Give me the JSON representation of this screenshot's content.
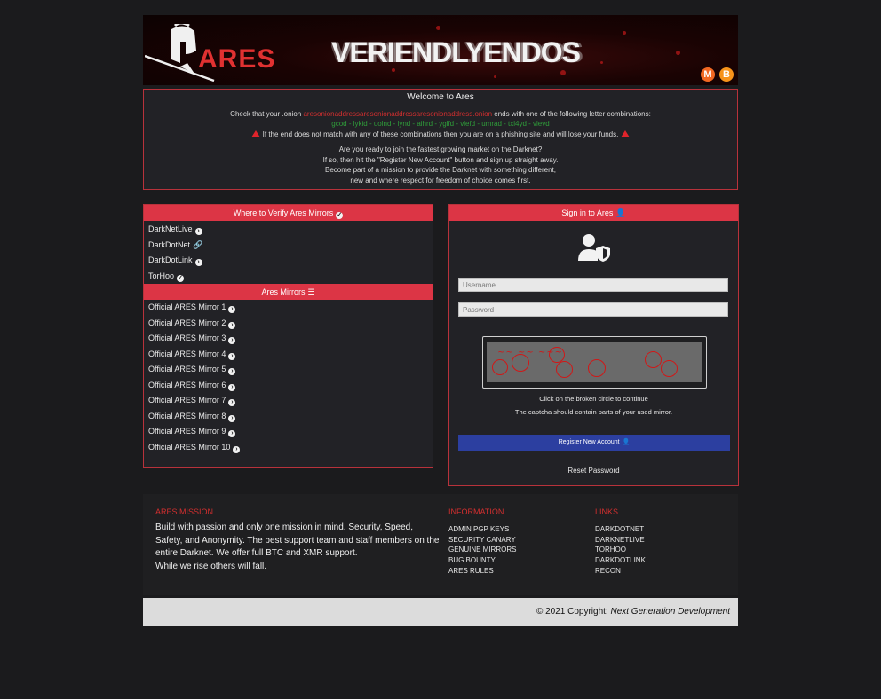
{
  "banner": {
    "logo_text": "ARES",
    "glitch_text": "VERIENDLYENDOS",
    "coins": [
      {
        "name": "monero-icon",
        "symbol": "M",
        "color": "#f26822"
      },
      {
        "name": "bitcoin-icon",
        "symbol": "B",
        "color": "#f7931a"
      }
    ]
  },
  "welcome": {
    "title": "Welcome to Ares",
    "check_prefix": "Check that your .onion",
    "onion_address": "aresonionaddressaresonionaddressaresonionaddress.onion",
    "check_suffix": "ends with one of the following letter combinations:",
    "combinations": "gcod - lykid - uolnd - lynd - aihrd - yglfd - vlefd - umrad - txl4yd - vlevd",
    "phishing_warning": "If the end does not match with any of these combinations then you are on a phishing site and will lose your funds.",
    "pitch_1": "Are you ready to join the fastest growing market on the Darknet?",
    "pitch_2": "If so, then hit the \"Register New Account\" button and sign up straight away.",
    "pitch_3": "Become part of a mission to provide the Darknet with something different,",
    "pitch_4": "new and where respect for freedom of choice comes first."
  },
  "verify": {
    "header": "Where to Verify Ares Mirrors",
    "items": [
      {
        "label": "DarkNetLive",
        "icon": "arrow-circle"
      },
      {
        "label": "DarkDotNet",
        "icon": "link"
      },
      {
        "label": "DarkDotLink",
        "icon": "arrow-circle"
      },
      {
        "label": "TorHoo",
        "icon": "check-circle"
      }
    ]
  },
  "mirrors": {
    "header": "Ares Mirrors",
    "items": [
      "Official ARES Mirror 1",
      "Official ARES Mirror 2",
      "Official ARES Mirror 3",
      "Official ARES Mirror 4",
      "Official ARES Mirror 5",
      "Official ARES Mirror 6",
      "Official ARES Mirror 7",
      "Official ARES Mirror 8",
      "Official ARES Mirror 9",
      "Official ARES Mirror 10"
    ]
  },
  "signin": {
    "header": "Sign in to Ares",
    "username_placeholder": "Username",
    "password_placeholder": "Password",
    "captcha_hint_1": "Click on the broken circle to continue",
    "captcha_hint_2": "The captcha should contain parts of your used mirror.",
    "register_label": "Register New Account",
    "reset_label": "Reset Password"
  },
  "footer": {
    "mission_title": "ARES MISSION",
    "mission_text_1": "Build with passion and only one mission in mind. Security, Speed,",
    "mission_text_2": "Safety, and Anonymity. The best support team and staff members on the",
    "mission_text_3": "entire Darknet. We offer full BTC and XMR support.",
    "mission_text_4": "While we rise others will fall.",
    "info_title": "INFORMATION",
    "info_items": [
      "ADMIN PGP KEYS",
      "SECURITY CANARY",
      "GENUINE MIRRORS",
      "BUG BOUNTY",
      "ARES RULES"
    ],
    "links_title": "LINKS",
    "links_items": [
      "DARKDOTNET",
      "DARKNETLIVE",
      "TORHOO",
      "DARKDOTLINK",
      "RECON"
    ],
    "copyright_prefix": "© 2021 Copyright:",
    "copyright_name": "Next Generation Development"
  },
  "colors": {
    "accent_red": "#dc3545",
    "register_blue": "#2c3fa0",
    "page_bg": "#1b1b1d"
  }
}
